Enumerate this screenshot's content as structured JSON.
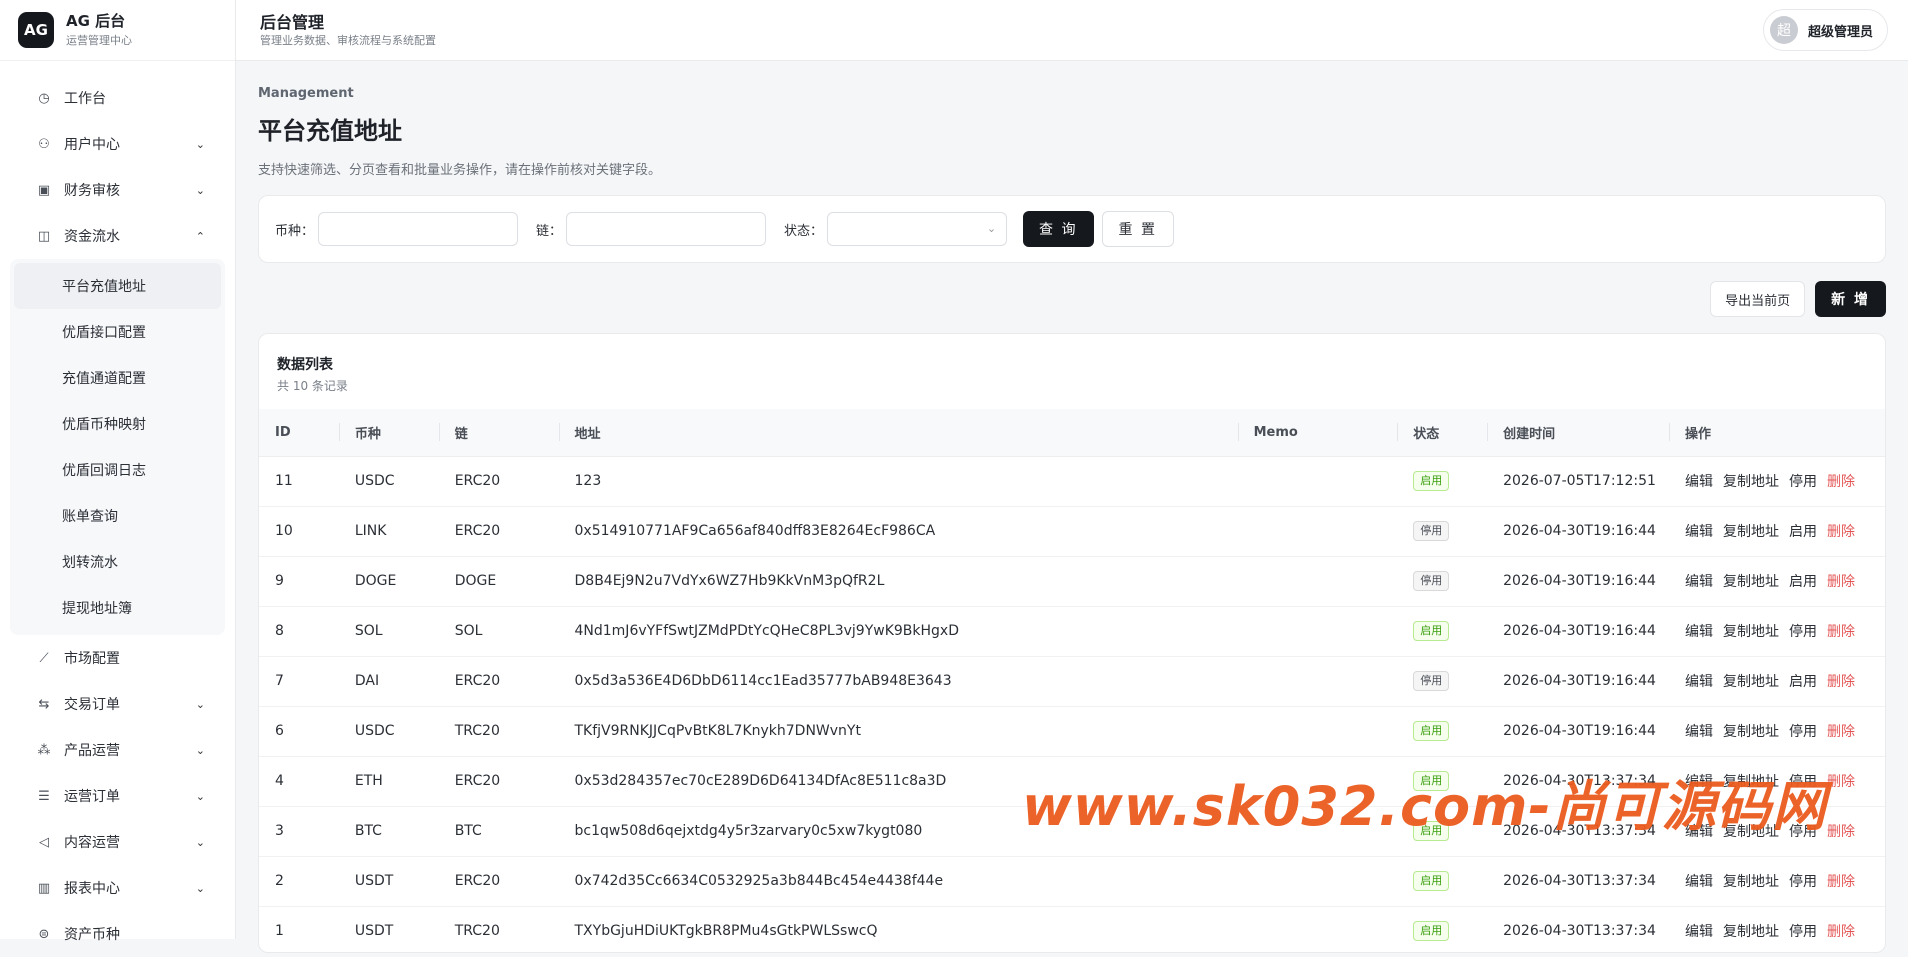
{
  "brand": {
    "logo": "AG",
    "title": "AG 后台",
    "subtitle": "运营管理中心"
  },
  "sidebar": {
    "items_top": [
      {
        "label": "工作台",
        "icon": "dashboard-icon",
        "chev": ""
      },
      {
        "label": "用户中心",
        "icon": "user-icon",
        "chev": "⌄"
      },
      {
        "label": "财务审核",
        "icon": "audit-icon",
        "chev": "⌄"
      },
      {
        "label": "资金流水",
        "icon": "wallet-icon",
        "chev": "⌃"
      }
    ],
    "submenu": [
      "平台充值地址",
      "优盾接口配置",
      "充值通道配置",
      "优盾币种映射",
      "优盾回调日志",
      "账单查询",
      "划转流水",
      "提现地址簿"
    ],
    "items_bottom": [
      {
        "label": "市场配置",
        "icon": "chart-line-icon",
        "chev": ""
      },
      {
        "label": "交易订单",
        "icon": "exchange-icon",
        "chev": "⌄"
      },
      {
        "label": "产品运营",
        "icon": "cluster-icon",
        "chev": "⌄"
      },
      {
        "label": "运营订单",
        "icon": "order-icon",
        "chev": "⌄"
      },
      {
        "label": "内容运营",
        "icon": "megaphone-icon",
        "chev": "⌄"
      },
      {
        "label": "报表中心",
        "icon": "bar-chart-icon",
        "chev": "⌄"
      },
      {
        "label": "资产币种",
        "icon": "coin-icon",
        "chev": ""
      }
    ]
  },
  "topbar": {
    "title": "后台管理",
    "subtitle": "管理业务数据、审核流程与系统配置",
    "avatar": "超",
    "user": "超级管理员"
  },
  "page": {
    "eyebrow": "Management",
    "title": "平台充值地址",
    "desc": "支持快速筛选、分页查看和批量业务操作，请在操作前核对关键字段。"
  },
  "filters": {
    "coin_label": "币种：",
    "chain_label": "链：",
    "status_label": "状态：",
    "query": "查 询",
    "reset": "重 置"
  },
  "actions": {
    "export": "导出当前页",
    "add": "新 增"
  },
  "table": {
    "title": "数据列表",
    "count": "共 10 条记录",
    "columns": [
      "ID",
      "币种",
      "链",
      "地址",
      "Memo",
      "状态",
      "创建时间",
      "操作"
    ],
    "ops": {
      "edit": "编辑",
      "copy": "复制地址",
      "delete": "删除"
    },
    "rows": [
      {
        "id": "11",
        "coin": "USDC",
        "chain": "ERC20",
        "address": "123",
        "memo": "",
        "status": "启用",
        "on": true,
        "time": "2026-07-05T17:12:51",
        "toggle": "停用"
      },
      {
        "id": "10",
        "coin": "LINK",
        "chain": "ERC20",
        "address": "0x514910771AF9Ca656af840dff83E8264EcF986CA",
        "memo": "",
        "status": "停用",
        "on": false,
        "time": "2026-04-30T19:16:44",
        "toggle": "启用"
      },
      {
        "id": "9",
        "coin": "DOGE",
        "chain": "DOGE",
        "address": "D8B4Ej9N2u7VdYx6WZ7Hb9KkVnM3pQfR2L",
        "memo": "",
        "status": "停用",
        "on": false,
        "time": "2026-04-30T19:16:44",
        "toggle": "启用"
      },
      {
        "id": "8",
        "coin": "SOL",
        "chain": "SOL",
        "address": "4Nd1mJ6vYFfSwtJZMdPDtYcQHeC8PL3vj9YwK9BkHgxD",
        "memo": "",
        "status": "启用",
        "on": true,
        "time": "2026-04-30T19:16:44",
        "toggle": "停用"
      },
      {
        "id": "7",
        "coin": "DAI",
        "chain": "ERC20",
        "address": "0x5d3a536E4D6DbD6114cc1Ead35777bAB948E3643",
        "memo": "",
        "status": "停用",
        "on": false,
        "time": "2026-04-30T19:16:44",
        "toggle": "启用"
      },
      {
        "id": "6",
        "coin": "USDC",
        "chain": "TRC20",
        "address": "TKfjV9RNKJJCqPvBtK8L7Knykh7DNWvnYt",
        "memo": "",
        "status": "启用",
        "on": true,
        "time": "2026-04-30T19:16:44",
        "toggle": "停用"
      },
      {
        "id": "4",
        "coin": "ETH",
        "chain": "ERC20",
        "address": "0x53d284357ec70cE289D6D64134DfAc8E511c8a3D",
        "memo": "",
        "status": "启用",
        "on": true,
        "time": "2026-04-30T13:37:34",
        "toggle": "停用"
      },
      {
        "id": "3",
        "coin": "BTC",
        "chain": "BTC",
        "address": "bc1qw508d6qejxtdg4y5r3zarvary0c5xw7kygt080",
        "memo": "",
        "status": "启用",
        "on": true,
        "time": "2026-04-30T13:37:34",
        "toggle": "停用"
      },
      {
        "id": "2",
        "coin": "USDT",
        "chain": "ERC20",
        "address": "0x742d35Cc6634C0532925a3b844Bc454e4438f44e",
        "memo": "",
        "status": "启用",
        "on": true,
        "time": "2026-04-30T13:37:34",
        "toggle": "停用"
      },
      {
        "id": "1",
        "coin": "USDT",
        "chain": "TRC20",
        "address": "TXYbGjuHDiUKTgkBR8PMu4sGtkPWLSswcQ",
        "memo": "",
        "status": "启用",
        "on": true,
        "time": "2026-04-30T13:37:34",
        "toggle": "停用"
      }
    ]
  },
  "watermark": "www.sk032.com-尚可源码网"
}
